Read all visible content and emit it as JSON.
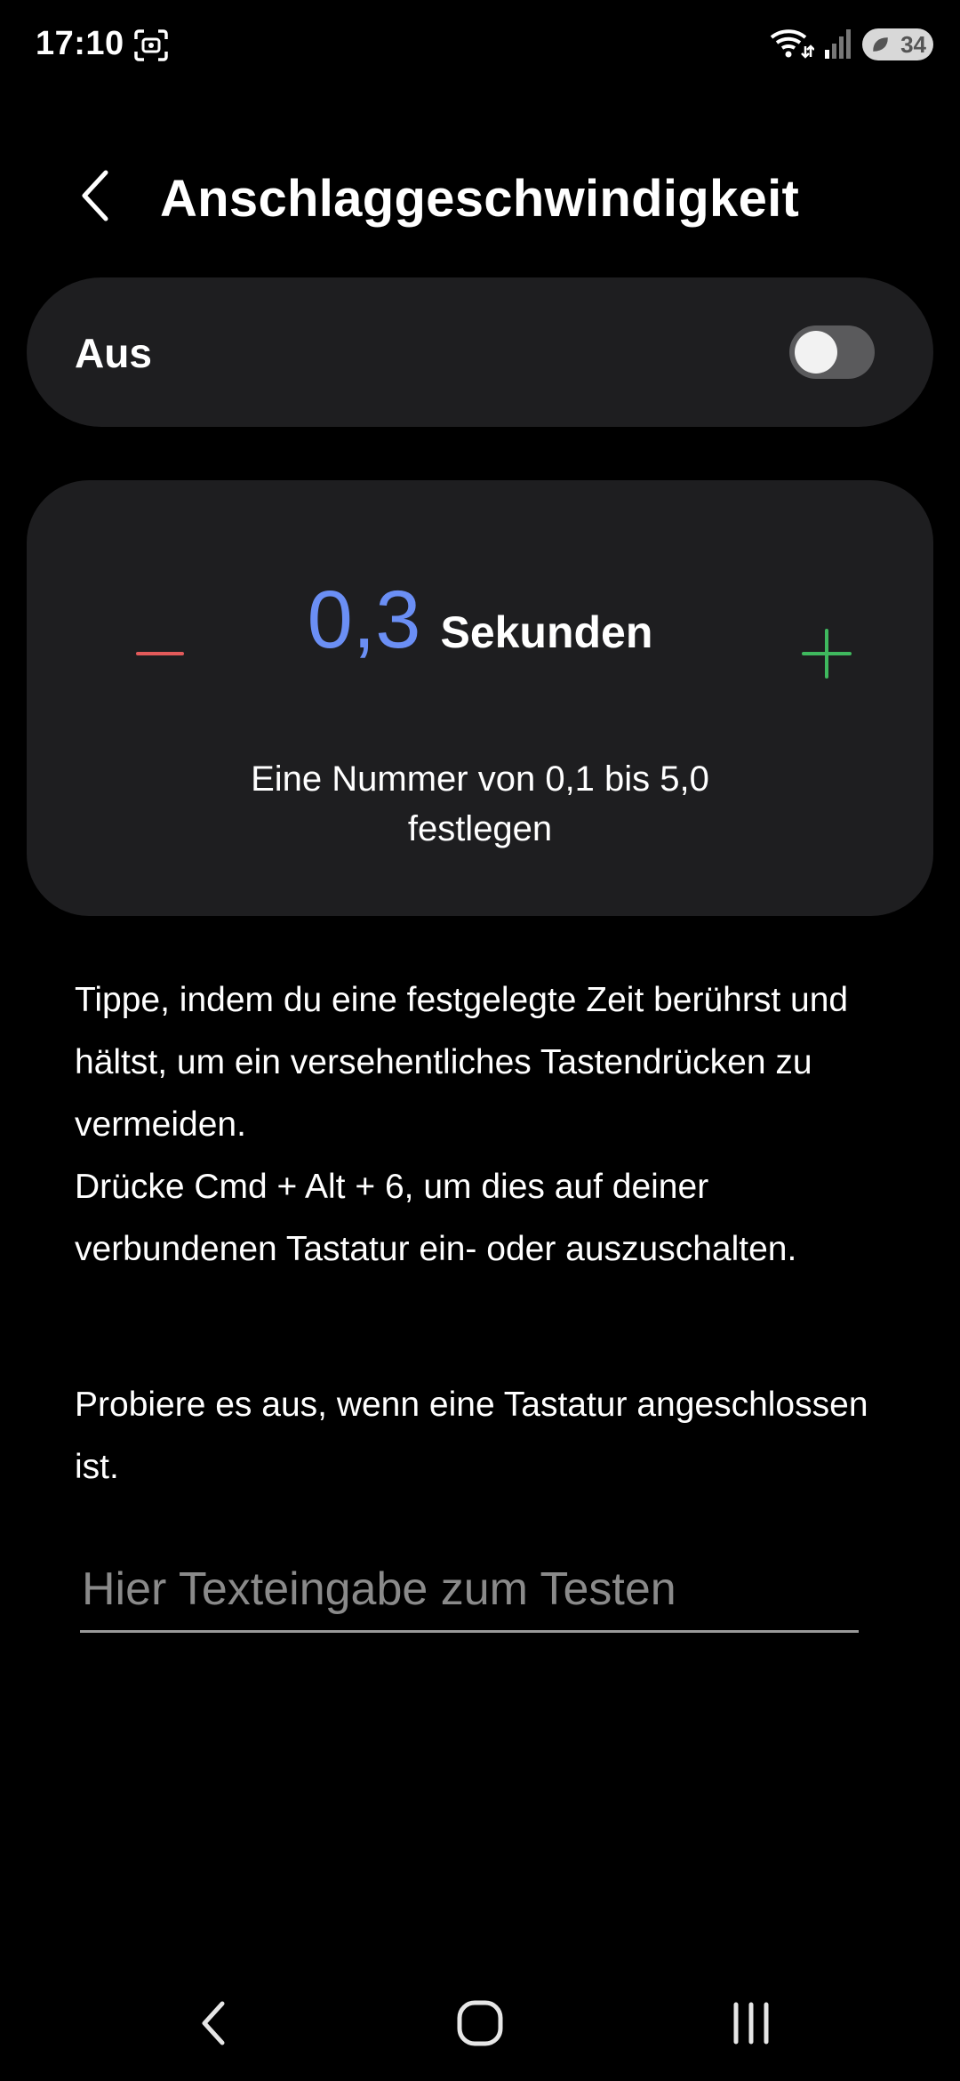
{
  "status_bar": {
    "time": "17:10",
    "wifi_badge": "6",
    "battery": "34"
  },
  "header": {
    "title": "Anschlaggeschwindigkeit",
    "back_icon": "chevron-left-icon"
  },
  "toggle": {
    "label": "Aus",
    "checked": false
  },
  "value_control": {
    "value": "0,3",
    "unit": "Sekunden",
    "hint": "Eine Nummer von 0,1 bis 5,0 festlegen",
    "minus_color": "#e35a5a",
    "plus_color": "#3fb95e",
    "value_color": "#6b8ff5"
  },
  "description": {
    "line1": "Tippe, indem du eine festgelegte Zeit berührst und hältst, um ein versehentliches Tastendrücken zu vermeiden.",
    "line2": "Drücke Cmd + Alt + 6, um dies auf deiner verbundenen Tastatur ein- oder auszuschalten."
  },
  "try_text": "Probiere es aus, wenn eine Tastatur angeschlossen ist.",
  "test_input": {
    "placeholder": "Hier Texteingabe zum Testen",
    "value": ""
  },
  "nav_bar": {
    "back_icon": "nav-back-icon",
    "home_icon": "nav-home-icon",
    "recents_icon": "nav-recents-icon"
  }
}
